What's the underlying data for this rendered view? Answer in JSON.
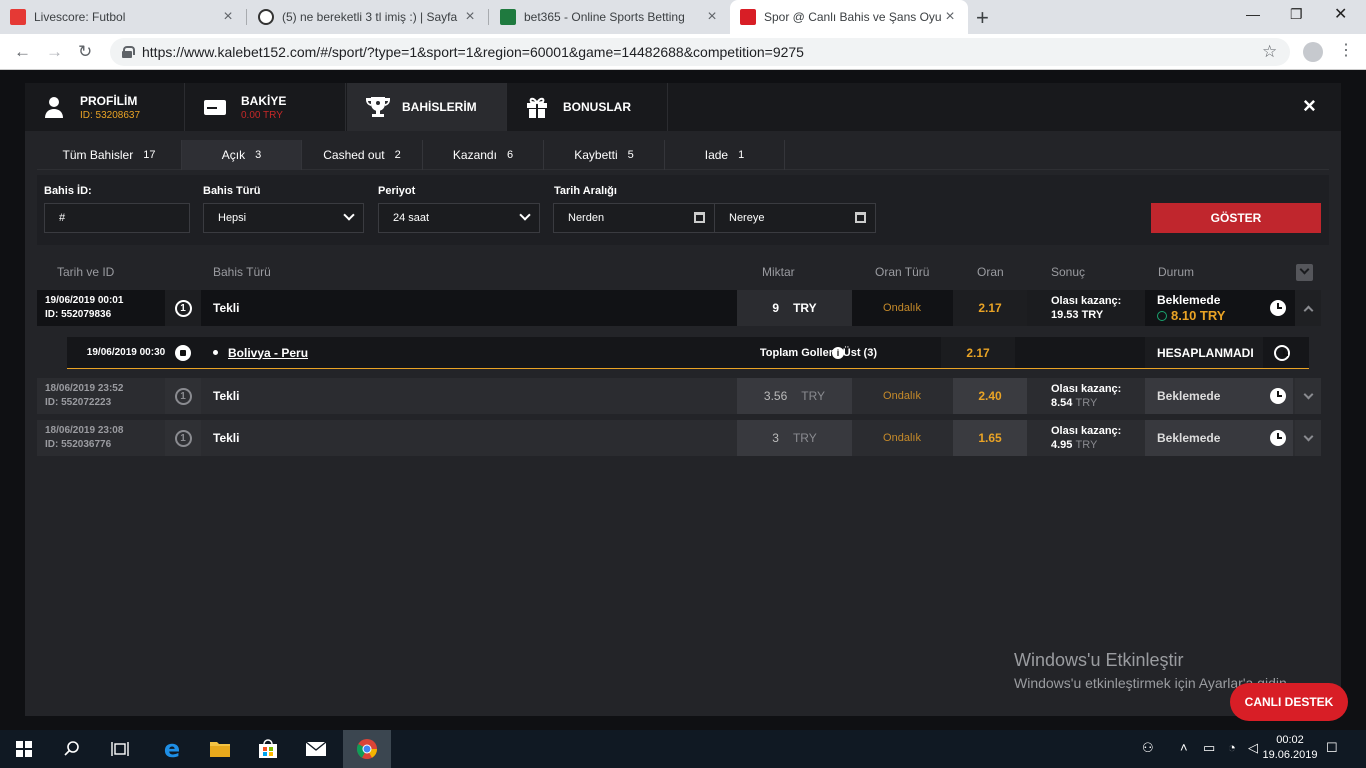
{
  "browser": {
    "tabs": [
      {
        "title": "Livescore: Futbol",
        "icon": "livescore-favicon",
        "color": "#e53935"
      },
      {
        "title": "(5) ne bereketli 3 tl imiş :) | Sayfa",
        "icon": "soccer-ball-favicon",
        "color": "#333333"
      },
      {
        "title": "bet365 - Online Sports Betting",
        "icon": "bet365-favicon",
        "color": "#1f7a3f"
      },
      {
        "title": "Spor @ Canlı Bahis ve Şans Oyunl",
        "icon": "kalebet-favicon",
        "color": "#d81e26"
      }
    ],
    "url": "https://www.kalebet152.com/#/sport/?type=1&sport=1&region=60001&game=14482688&competition=9275"
  },
  "modal": {
    "tabs": [
      {
        "label": "PROFİLİM",
        "sub": "ID: 53208637",
        "icon": "user-icon"
      },
      {
        "label": "BAKİYE",
        "sub": "0.00 TRY",
        "icon": "wallet-icon"
      },
      {
        "label": "BAHİSLERİM",
        "sub": "",
        "icon": "trophy-icon"
      },
      {
        "label": "BONUSLAR",
        "sub": "",
        "icon": "gift-icon"
      }
    ],
    "close": "×"
  },
  "subtabs": [
    {
      "label": "Tüm Bahisler",
      "count": "17"
    },
    {
      "label": "Açık",
      "count": "3"
    },
    {
      "label": "Cashed out",
      "count": "2"
    },
    {
      "label": "Kazandı",
      "count": "6"
    },
    {
      "label": "Kaybetti",
      "count": "5"
    },
    {
      "label": "Iade",
      "count": "1"
    }
  ],
  "filters": {
    "bet_id_label": "Bahis İD:",
    "bet_id_placeholder": "#",
    "bet_type_label": "Bahis Türü",
    "bet_type_value": "Hepsi",
    "period_label": "Periyot",
    "period_value": "24 saat",
    "range_label": "Tarih Aralığı",
    "from": "Nerden",
    "to": "Nereye",
    "show_button": "GÖSTER"
  },
  "table": {
    "headers": [
      "Tarih ve ID",
      "Bahis Türü",
      "Miktar",
      "Oran Türü",
      "Oran",
      "Sonuç",
      "Durum"
    ],
    "rows": [
      {
        "date": "19/06/2019 00:01",
        "id": "ID: 552079836",
        "num": "1",
        "type": "Tekli",
        "amount": "9",
        "currency": "TRY",
        "odds_type": "Ondalık",
        "odds": "2.17",
        "result_label": "Olası kazanç:",
        "result_value": "19.53 TRY",
        "status": "Beklemede",
        "cashout": "8.10 TRY"
      },
      {
        "date": "18/06/2019 23:52",
        "id": "ID: 552072223",
        "num": "1",
        "type": "Tekli",
        "amount": "3.56",
        "currency": "TRY",
        "odds_type": "Ondalık",
        "odds": "2.40",
        "result_label": "Olası kazanç:",
        "result_value": "8.54",
        "result_currency": "TRY",
        "status": "Beklemede"
      },
      {
        "date": "18/06/2019 23:08",
        "id": "ID: 552036776",
        "num": "1",
        "type": "Tekli",
        "amount": "3",
        "currency": "TRY",
        "odds_type": "Ondalık",
        "odds": "1.65",
        "result_label": "Olası kazanç:",
        "result_value": "4.95",
        "result_currency": "TRY",
        "status": "Beklemede"
      }
    ],
    "detail": {
      "date": "19/06/2019 00:30",
      "match": "Bolivya - Peru",
      "market": "Toplam Goller - Üst (3)",
      "odds": "2.17",
      "status": "HESAPLANMADI"
    }
  },
  "watermark": {
    "line1": "Windows'u Etkinleştir",
    "line2": "Windows'u etkinleştirmek için Ayarlar'a gidin."
  },
  "live_support": "CANLI DESTEK",
  "taskbar": {
    "time": "00:02",
    "date": "19.06.2019"
  }
}
